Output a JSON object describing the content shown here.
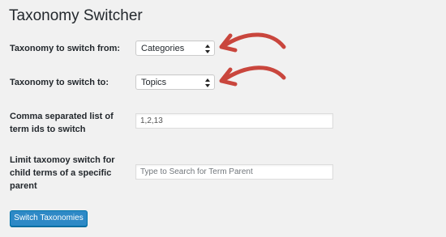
{
  "page": {
    "title": "Taxonomy Switcher"
  },
  "form": {
    "from": {
      "label": "Taxonomy to switch from:",
      "selected": "Categories"
    },
    "to": {
      "label": "Taxonomy to switch to:",
      "selected": "Topics"
    },
    "term_ids": {
      "label_line1": "Comma separated list of",
      "label_line2": "term ids to switch",
      "value": "1,2,13"
    },
    "parent": {
      "label_line1": "Limit taxomoy switch for",
      "label_line2": "child terms of a specific",
      "label_line3": "parent",
      "placeholder": "Type to Search for Term Parent"
    },
    "submit_label": "Switch Taxonomies"
  },
  "annotations": {
    "arrow_color": "#c9463d"
  },
  "colors": {
    "background": "#f1f1f1",
    "primary_button": "#2e89c6"
  }
}
